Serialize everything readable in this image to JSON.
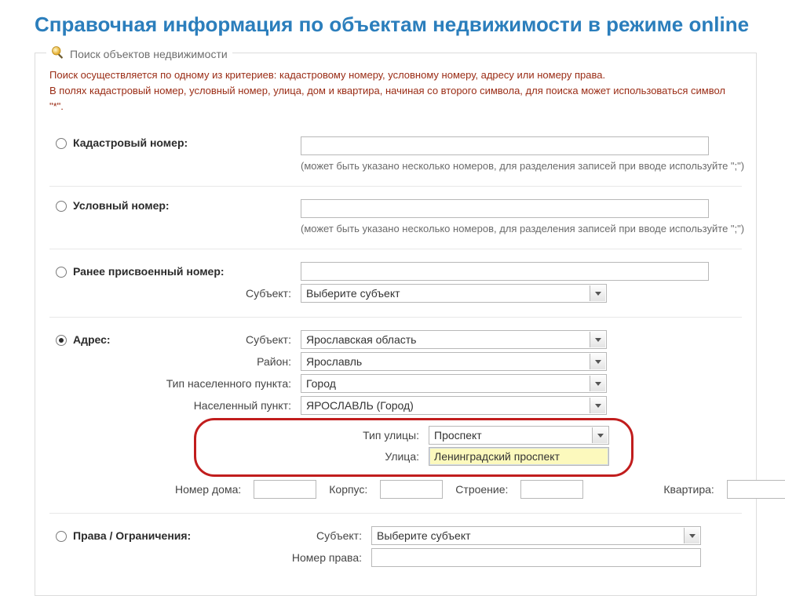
{
  "page": {
    "title": "Справочная информация по объектам недвижимости в режиме online"
  },
  "search": {
    "legend": "Поиск объектов недвижимости",
    "warn1": "Поиск осуществляется по одному из критериев: кадастровому номеру, условному номеру, адресу или номеру права.",
    "warn2": "В полях кадастровый номер, условный номер, улица, дом и квартира, начиная со второго символа, для поиска может использоваться символ \"*\"."
  },
  "labels": {
    "cad": "Кадастровый номер:",
    "cad_hint": "(может быть указано несколько номеров, для разделения записей при вводе используйте \";\")",
    "cond": "Условный номер:",
    "cond_hint": "(может быть указано несколько номеров, для разделения записей при вводе используйте \";\")",
    "prev": "Ранее присвоенный номер:",
    "subj": "Субъект:",
    "subj_placeholder": "Выберите субъект",
    "addr": "Адрес:",
    "rayon": "Район:",
    "loc_type": "Тип населенного пункта:",
    "locality": "Населенный пункт:",
    "street_type": "Тип улицы:",
    "street": "Улица:",
    "house": "Номер дома:",
    "korpus": "Корпус:",
    "building": "Строение:",
    "flat": "Квартира:",
    "rights": "Права / Ограничения:",
    "right_no": "Номер права:"
  },
  "addr": {
    "subj": "Ярославская область",
    "rayon": "Ярославль",
    "loc_type": "Город",
    "locality": "ЯРОСЛАВЛЬ (Город)",
    "street_type": "Проспект",
    "street": "Ленинградский проспект",
    "house": "",
    "korpus": "",
    "building": "",
    "flat": ""
  },
  "rights": {
    "subj": "Выберите субъект",
    "right_no": ""
  }
}
